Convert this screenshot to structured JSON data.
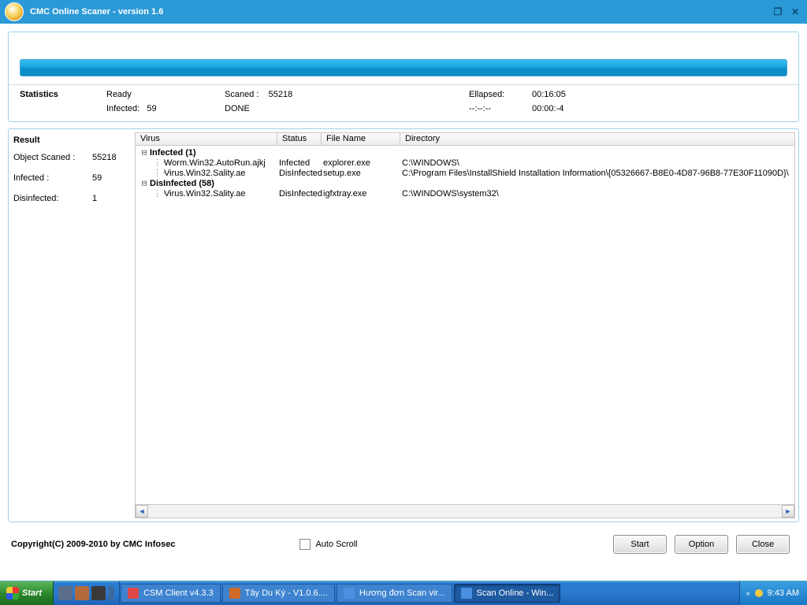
{
  "window": {
    "title": "CMC Online Scaner - version 1.6"
  },
  "progress": {
    "percent": 100
  },
  "stats": {
    "title": "Statistics",
    "ready_label": "Ready",
    "infected_label": "Infected:",
    "infected_count": "59",
    "scaned_label": "Scaned :",
    "scaned_count": "55218",
    "done_label": "DONE",
    "elapsed_label": "Ellapsed:",
    "elapsed_value": "00:16:05",
    "est_label": "--:--:--",
    "est_value": "00:00:-4"
  },
  "result": {
    "title": "Result",
    "object_scaned_label": "Object Scaned :",
    "object_scaned_value": "55218",
    "infected_label": "Infected :",
    "infected_value": "59",
    "disinfected_label": "Disinfected:",
    "disinfected_value": "1"
  },
  "grid": {
    "headers": {
      "virus": "Virus",
      "status": "Status",
      "file": "File Name",
      "dir": "Directory"
    },
    "groups": [
      {
        "label": "Infected (1)",
        "rows": [
          {
            "virus": "Worm.Win32.AutoRun.ajkj",
            "status": "Infected",
            "file": "explorer.exe",
            "dir": "C:\\WINDOWS\\"
          },
          {
            "virus": "Virus.Win32.Sality.ae",
            "status": "DisInfected",
            "file": "setup.exe",
            "dir": "C:\\Program Files\\InstallShield Installation Information\\{05326667-B8E0-4D87-96B8-77E30F11090D}\\"
          }
        ]
      },
      {
        "label": "DisInfected (58)",
        "rows": [
          {
            "virus": "Virus.Win32.Sality.ae",
            "status": "DisInfected",
            "file": "igfxtray.exe",
            "dir": "C:\\WINDOWS\\system32\\"
          }
        ]
      }
    ]
  },
  "footer": {
    "copyright": "Copyright(C) 2009-2010 by CMC Infosec",
    "auto_scroll": "Auto Scroll",
    "start": "Start",
    "option": "Option",
    "close": "Close"
  },
  "taskbar": {
    "start": "Start",
    "items": [
      {
        "label": "CSM Client v4.3.3",
        "color": "#e04848"
      },
      {
        "label": "Tây Du Ký - V1.0.6....",
        "color": "#d06a2a"
      },
      {
        "label": "Hương đơn Scan vir...",
        "color": "#4a8fe0"
      },
      {
        "label": "Scan Online - Win...",
        "color": "#4a8fe0",
        "active": true
      }
    ],
    "clock": "9:43 AM"
  }
}
